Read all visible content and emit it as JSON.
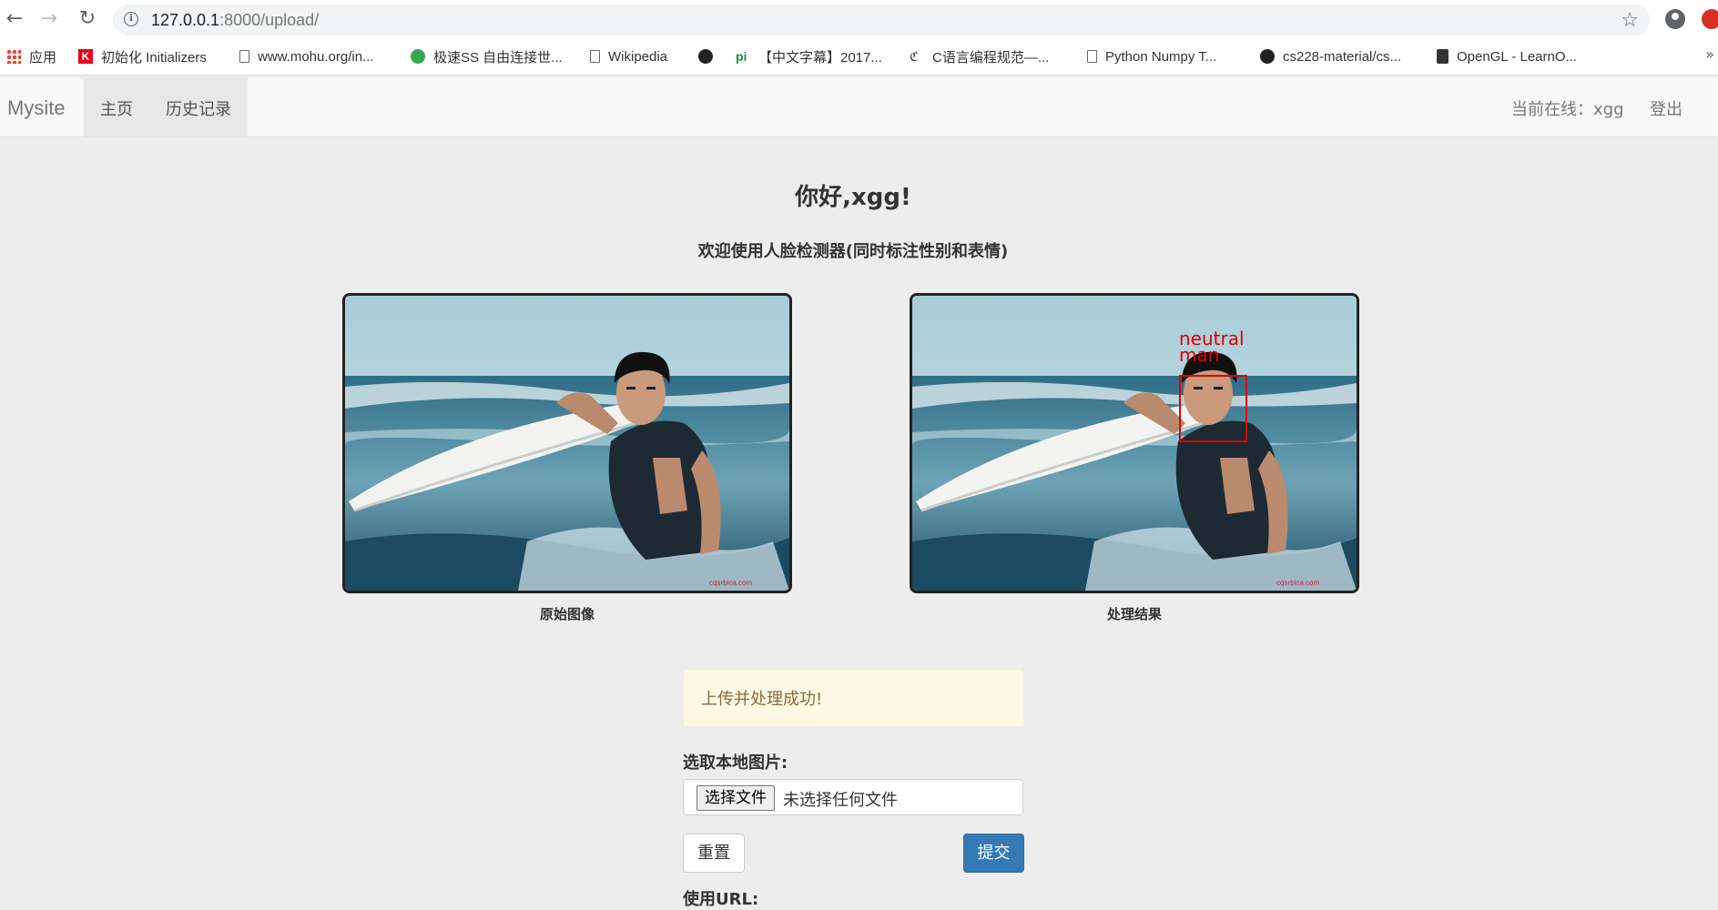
{
  "browser": {
    "url_host": "127.0.0.1",
    "url_path": ":8000/upload/",
    "bookmarks": [
      {
        "label": "应用",
        "icon": "apps-grid-icon"
      },
      {
        "label": "初始化 Initializers",
        "icon": "k-icon"
      },
      {
        "label": "www.mohu.org/in...",
        "icon": "document-icon"
      },
      {
        "label": "极速SS 自由连接世...",
        "icon": "paper-plane-icon"
      },
      {
        "label": "Wikipedia",
        "icon": "document-icon"
      },
      {
        "label": "",
        "icon": "github-icon"
      },
      {
        "label": "【中文字幕】2017...",
        "icon": "pi-icon"
      },
      {
        "label": "C语言编程规范—...",
        "icon": "c-icon"
      },
      {
        "label": "Python Numpy T...",
        "icon": "document-icon"
      },
      {
        "label": "cs228-material/cs...",
        "icon": "github-icon"
      },
      {
        "label": "OpenGL - LearnO...",
        "icon": "book-icon"
      }
    ],
    "more": "»"
  },
  "navbar": {
    "brand": "Mysite",
    "links": [
      "主页",
      "历史记录"
    ],
    "online_user": "当前在线：xgg",
    "logout": "登出"
  },
  "main": {
    "greeting": "你好,xgg!",
    "subtitle": "欢迎使用人脸检测器(同时标注性别和表情)",
    "original_caption": "原始图像",
    "result_caption": "处理结果",
    "result_labels": [
      "neutral",
      "man"
    ],
    "watermark": "cqsrblca.com",
    "alert": "上传并处理成功!",
    "file_label": "选取本地图片:",
    "file_button": "选择文件",
    "file_status": "未选择任何文件",
    "reset_button": "重置",
    "submit_button": "提交",
    "url_label": "使用URL:"
  },
  "colors": {
    "primary": "#337ab7",
    "alert_bg": "#fcf8e3",
    "alert_text": "#8a6d3b",
    "detection_box": "#e00000"
  }
}
